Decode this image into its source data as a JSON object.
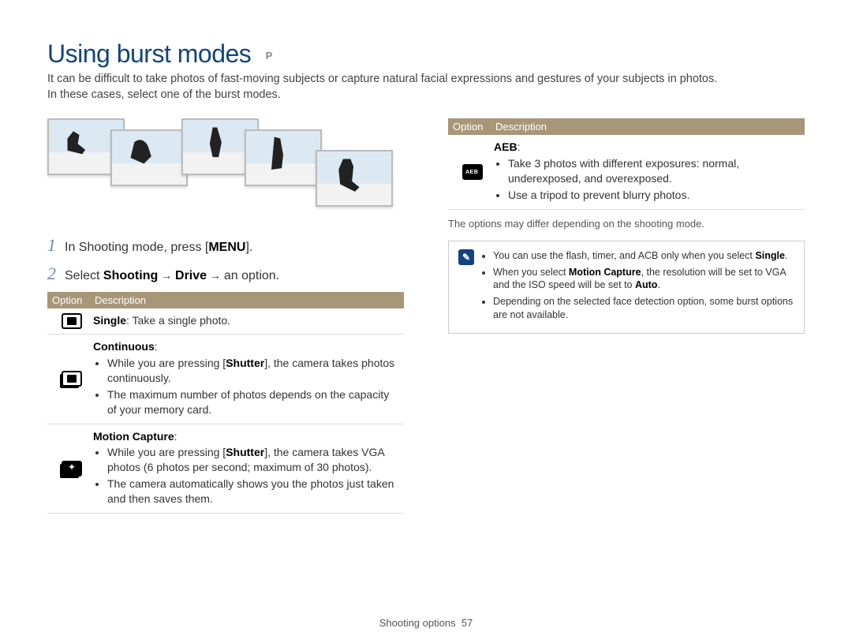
{
  "title": "Using burst modes",
  "mode_tag": "P",
  "intro_line1": "It can be difficult to take photos of fast-moving subjects or capture natural facial expressions and gestures of your subjects in photos.",
  "intro_line2": "In these cases, select one of the burst modes.",
  "steps": {
    "s1_prefix": "In Shooting mode, press [",
    "s1_bold": "MENU",
    "s1_suffix": "].",
    "s2_prefix": "Select ",
    "s2_b1": "Shooting",
    "s2_arrow": " → ",
    "s2_b2": "Drive",
    "s2_suffix": " an option."
  },
  "table_headers": {
    "option": "Option",
    "description": "Description"
  },
  "rows_left": {
    "single": {
      "name": "Single",
      "text": ": Take a single photo."
    },
    "continuous": {
      "name": "Continuous",
      "bullet1a": "While you are pressing [",
      "bullet1b": "Shutter",
      "bullet1c": "], the camera takes photos continuously.",
      "bullet2": "The maximum number of photos depends on the capacity of your memory card."
    },
    "motion": {
      "name": "Motion Capture",
      "bullet1a": "While you are pressing [",
      "bullet1b": "Shutter",
      "bullet1c": "], the camera takes VGA photos (6 photos per second; maximum of 30 photos).",
      "bullet2": "The camera automatically shows you the photos just taken and then saves them."
    }
  },
  "rows_right": {
    "aeb": {
      "name": "AEB",
      "bullet1": "Take 3 photos with different exposures: normal, underexposed, and overexposed.",
      "bullet2": "Use a tripod to prevent blurry photos."
    }
  },
  "note": "The options may differ depending on the shooting mode.",
  "info": {
    "li1a": "You can use the flash, timer, and ACB only when you select ",
    "li1b": "Single",
    "li1c": ".",
    "li2a": "When you select ",
    "li2b": "Motion Capture",
    "li2c": ", the resolution will be set to VGA and the ISO speed will be set to ",
    "li2d": "Auto",
    "li2e": ".",
    "li3": "Depending on the selected face detection option, some burst options are not available."
  },
  "footer": {
    "section": "Shooting options",
    "page": "57"
  }
}
